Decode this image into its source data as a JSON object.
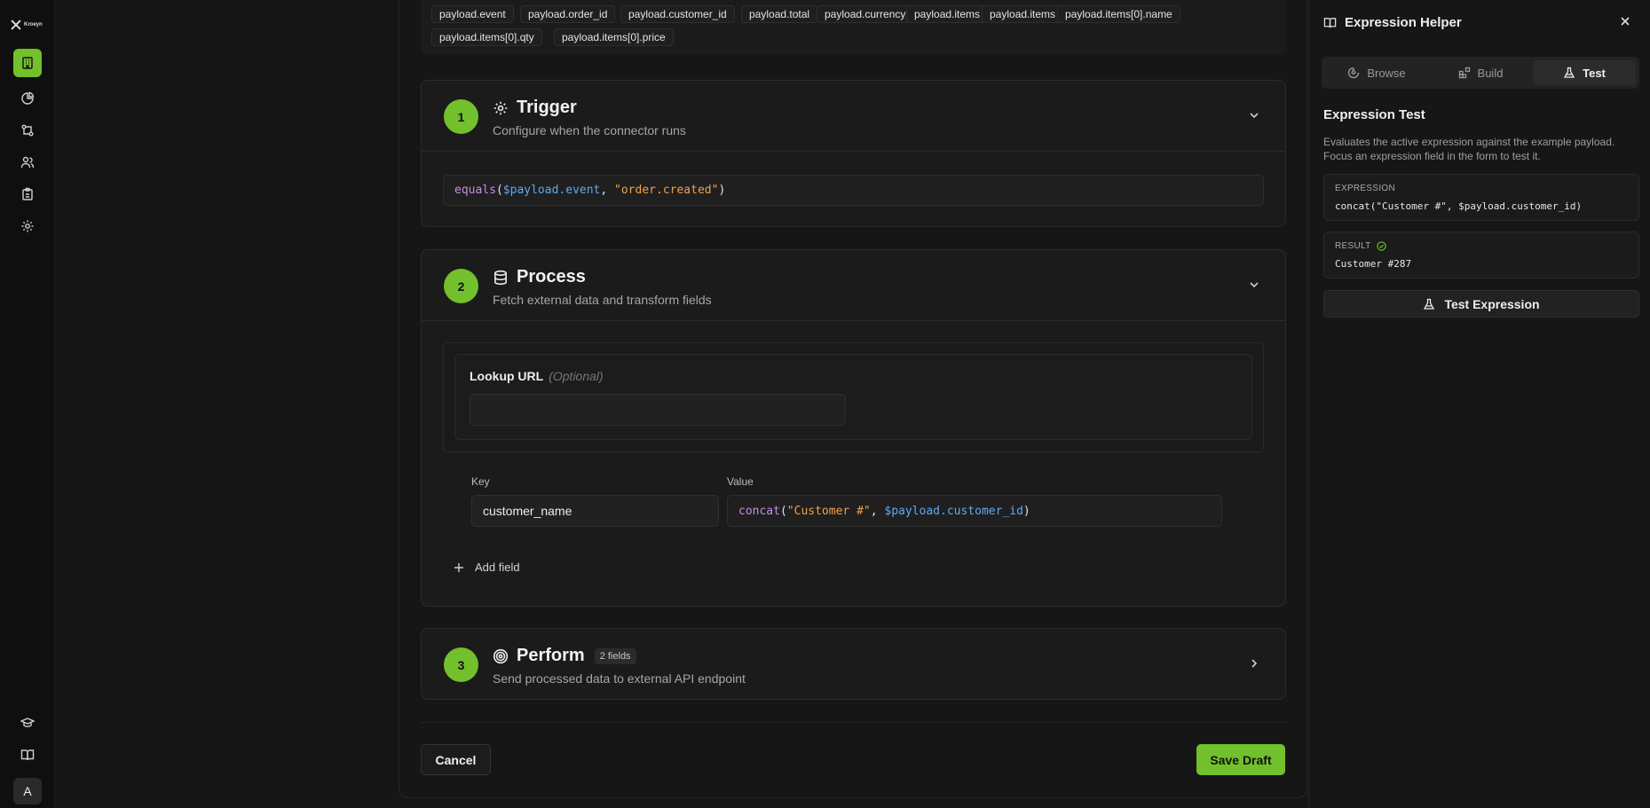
{
  "sidebar": {
    "logo_text": "Kroeyn",
    "avatar_initial": "A",
    "items": [
      {
        "icon": "building-icon",
        "active": true
      },
      {
        "icon": "pie-chart-icon"
      },
      {
        "icon": "workflow-icon"
      },
      {
        "icon": "users-icon"
      },
      {
        "icon": "clipboard-icon"
      },
      {
        "icon": "gear-icon"
      }
    ],
    "bottom": [
      {
        "icon": "graduation-cap-icon"
      },
      {
        "icon": "book-icon"
      }
    ]
  },
  "payload_chips": [
    "payload.event",
    "payload.order_id",
    "payload.customer_id",
    "payload.total",
    "payload.currency",
    "payload.items",
    "payload.items",
    "payload.items[0].name",
    "payload.items[0].qty",
    "payload.items[0].price"
  ],
  "trigger": {
    "step": "1",
    "title": "Trigger",
    "subtitle": "Configure when the connector runs",
    "expr": {
      "fn": "equals",
      "open": "(",
      "var": "$payload.event",
      "sep": ", ",
      "str": "\"order.created\"",
      "close": ")"
    }
  },
  "process": {
    "step": "2",
    "title": "Process",
    "subtitle": "Fetch external data and transform fields",
    "lookup_label": "Lookup URL",
    "lookup_optional": "(Optional)",
    "lookup_value": "",
    "key_label": "Key",
    "value_label": "Value",
    "key_value": "customer_name",
    "value_expr": {
      "fn": "concat",
      "open": "(",
      "str": "\"Customer #\"",
      "sep": ", ",
      "var": "$payload.customer_id",
      "close": ")"
    },
    "add_field": "Add field"
  },
  "perform": {
    "step": "3",
    "title": "Perform",
    "badge": "2 fields",
    "subtitle": "Send processed data to external API endpoint"
  },
  "actions": {
    "cancel": "Cancel",
    "save": "Save Draft"
  },
  "panel": {
    "title": "Expression Helper",
    "tabs": [
      {
        "label": "Browse",
        "icon": "browse-icon"
      },
      {
        "label": "Build",
        "icon": "blocks-icon"
      },
      {
        "label": "Test",
        "icon": "flask-icon",
        "active": true
      }
    ],
    "heading": "Expression Test",
    "description": "Evaluates the active expression against the example payload. Focus an expression field in the form to test it.",
    "expression_caption": "EXPRESSION",
    "expression_value": "concat(\"Customer #\", $payload.customer_id)",
    "result_caption": "RESULT",
    "result_value": "Customer #287",
    "test_button": "Test Expression"
  },
  "colors": {
    "accent": "#72c02c",
    "fn": "#c48fe6",
    "var": "#62a8f0",
    "str": "#f0a24a"
  }
}
